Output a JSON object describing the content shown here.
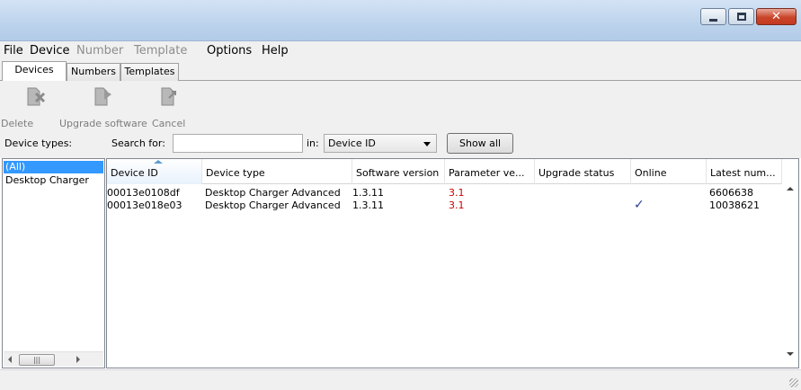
{
  "window": {
    "title": ""
  },
  "menu": [
    "File",
    "Device",
    "Number",
    "Template",
    "Options",
    "Help"
  ],
  "tabs": [
    "Devices",
    "Numbers",
    "Templates"
  ],
  "toolbar": {
    "delete": "Delete",
    "upgrade": "Upgrade software",
    "cancel": "Cancel"
  },
  "search": {
    "device_types_label": "Device types:",
    "search_for_label": "Search for:",
    "search_value": "",
    "in_label": "in:",
    "in_selected": "Device ID",
    "show_all": "Show all"
  },
  "device_types": [
    "(All)",
    "Desktop Charger"
  ],
  "grid": {
    "columns": [
      "Device ID",
      "Device type",
      "Software version",
      "Parameter ve...",
      "Upgrade status",
      "Online",
      "Latest num..."
    ],
    "rows": [
      {
        "device_id": "00013e0108df",
        "device_type": "Desktop Charger Advanced",
        "software_version": "1.3.11",
        "parameter_version": "3.1",
        "upgrade_status": "",
        "online": "",
        "latest_number": "6606638"
      },
      {
        "device_id": "00013e018e03",
        "device_type": "Desktop Charger Advanced",
        "software_version": "1.3.11",
        "parameter_version": "3.1",
        "upgrade_status": "",
        "online": "✓",
        "latest_number": "10038621"
      }
    ]
  },
  "colors": {
    "selection": "#3399ff",
    "parameter_text": "#cc0000",
    "online_check": "#2a3f9c"
  }
}
